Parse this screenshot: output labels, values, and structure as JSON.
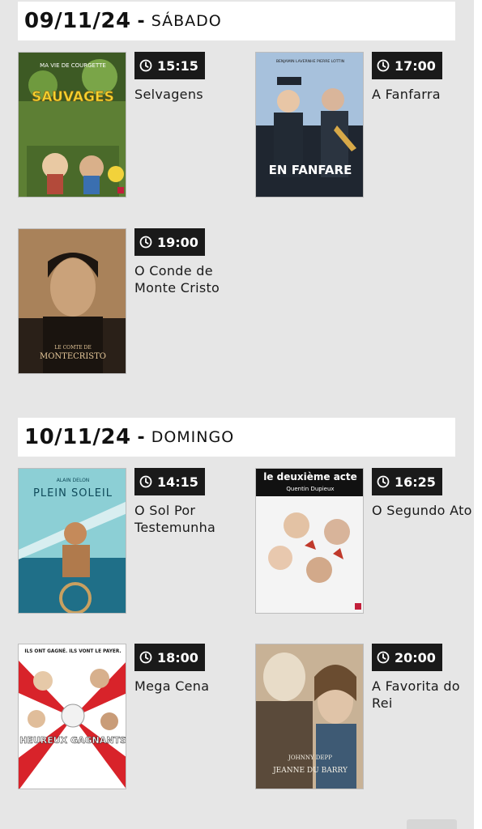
{
  "days": [
    {
      "date": "09/11/24",
      "separator": "-",
      "weekday": "SÁBADO",
      "movies": [
        {
          "time": "15:15",
          "title": "Selvagens",
          "poster": {
            "text": "SAUVAGES",
            "top_text": "MA VIE DE COURGETTE",
            "colors": [
              "#6b8f3a",
              "#3f5f2a",
              "#a7c06a"
            ]
          }
        },
        {
          "time": "17:00",
          "title": "A Fanfarra",
          "poster": {
            "text": "EN FANFARE",
            "top_text": "BENJAMIN LAVERNHE   PIERRE LOTTIN",
            "colors": [
              "#a9c3df",
              "#242a33",
              "#d9a441"
            ]
          }
        },
        {
          "time": "19:00",
          "title": "O Conde de Monte Cristo",
          "poster": {
            "text": "MONTECRISTO",
            "top_text": "LE COMTE DE",
            "colors": [
              "#b98c5a",
              "#2a2018",
              "#d8b07a"
            ]
          }
        }
      ]
    },
    {
      "date": "10/11/24",
      "separator": "-",
      "weekday": "DOMINGO",
      "movies": [
        {
          "time": "14:15",
          "title": "O Sol Por Testemunha",
          "poster": {
            "text": "PLEIN SOLEIL",
            "top_text": "ALAIN DELON",
            "colors": [
              "#8fd0d6",
              "#1e6f87",
              "#f0d9b5"
            ]
          }
        },
        {
          "time": "16:25",
          "title": "O Segundo Ato",
          "poster": {
            "text": "le deuxième acte",
            "top_text": "Quentin Dupieux",
            "colors": [
              "#f4f4f4",
              "#c0392b",
              "#1a1a1a"
            ]
          }
        },
        {
          "time": "18:00",
          "title": "Mega Cena",
          "poster": {
            "text": "HEUREUX GAGNANTS",
            "top_text": "ILS ONT GAGNÉ. ILS VONT LE PAYER.",
            "colors": [
              "#d8232a",
              "#ffffff",
              "#1a1a1a"
            ]
          }
        },
        {
          "time": "20:00",
          "title": "A Favorita do Rei",
          "poster": {
            "text": "JEANNE DU BARRY",
            "top_text": "JOHNNY DEPP",
            "colors": [
              "#c9b59a",
              "#5a4a3a",
              "#e8dcc8"
            ]
          }
        }
      ]
    }
  ]
}
